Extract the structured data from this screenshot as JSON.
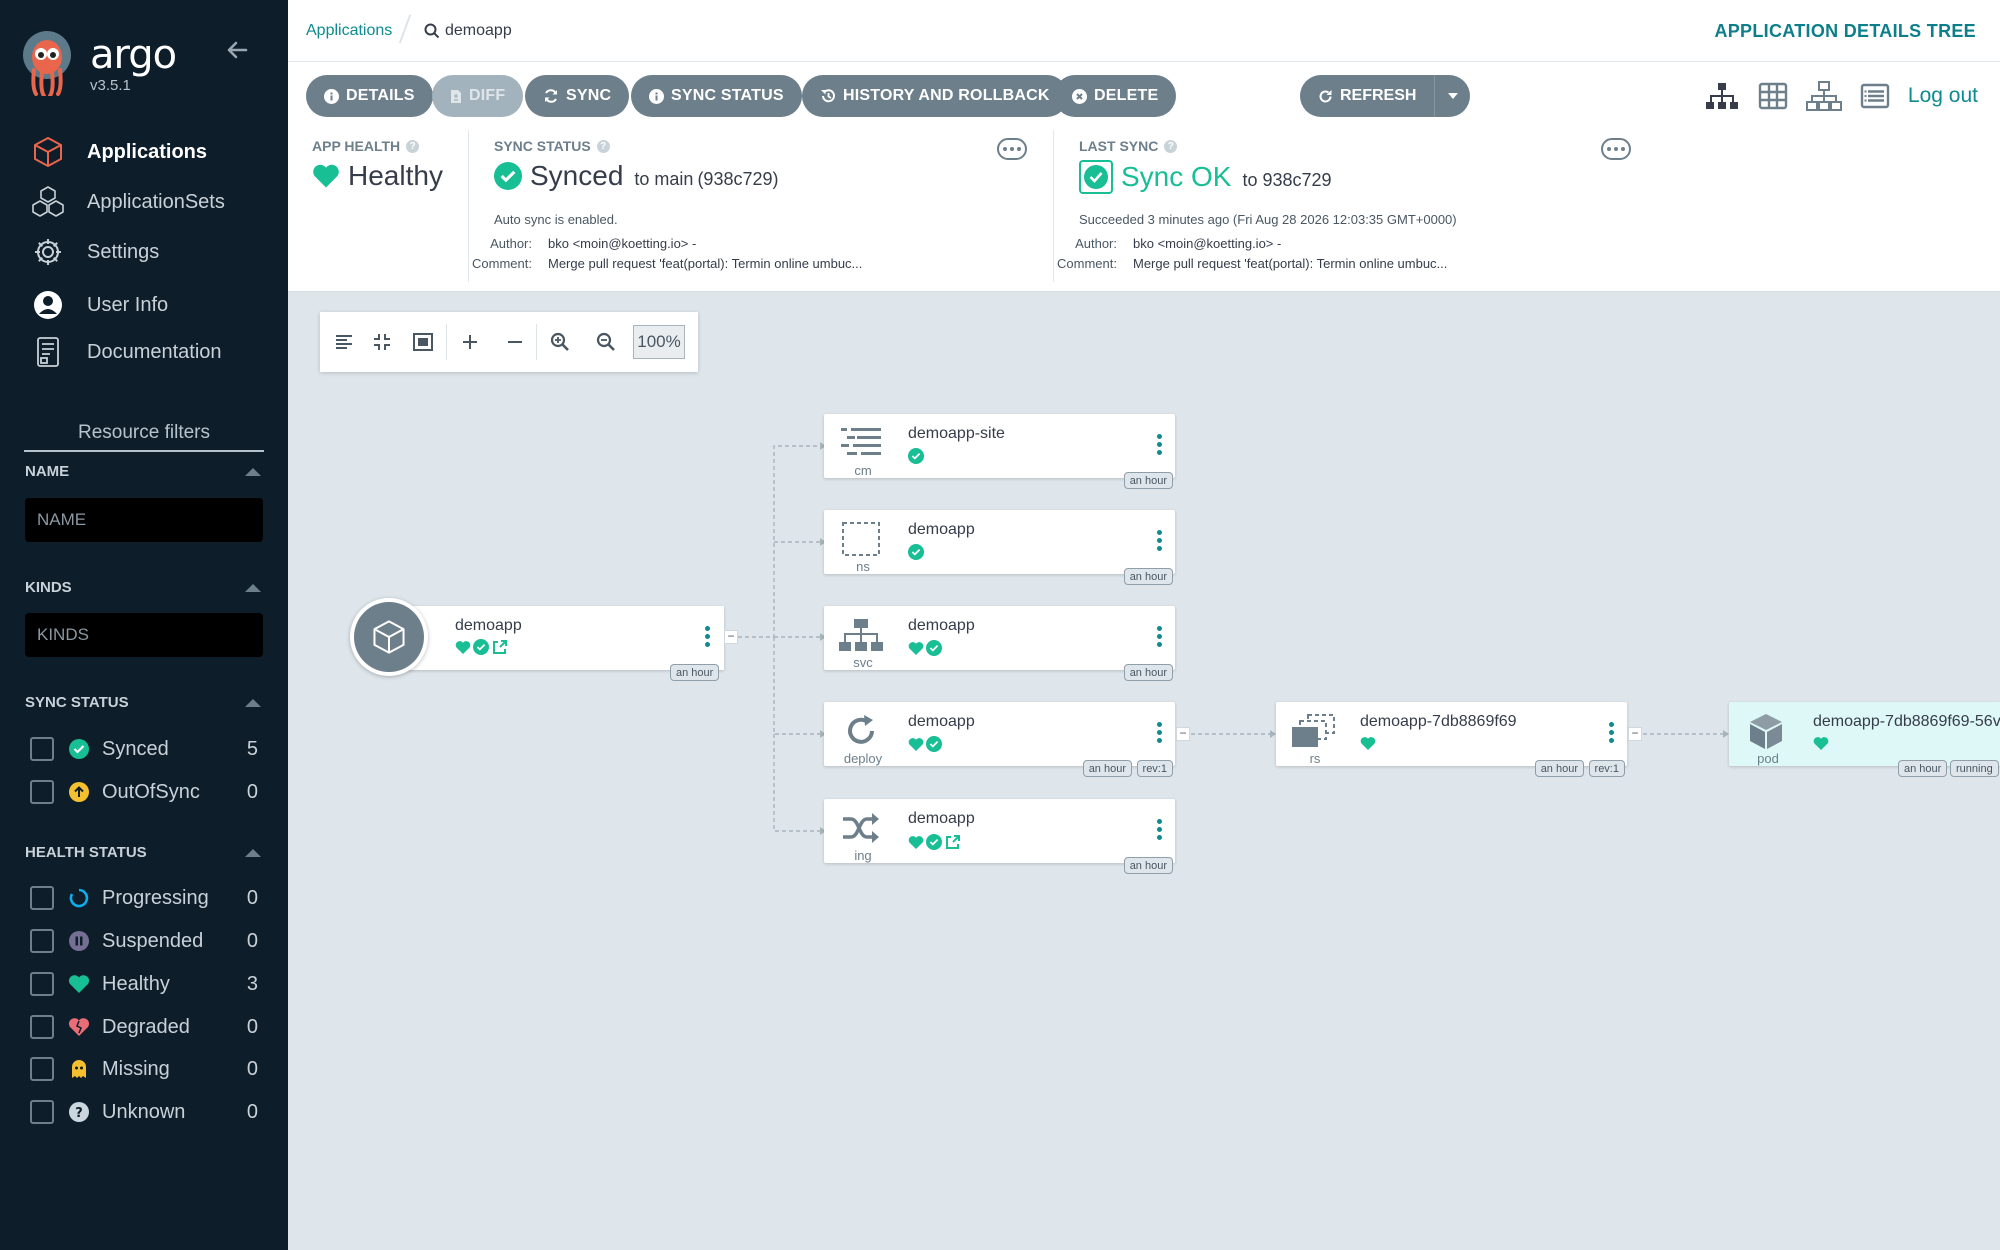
{
  "app": {
    "name": "argo",
    "version": "v3.5.1"
  },
  "sidebar": {
    "nav": [
      {
        "label": "Applications",
        "icon": "cube-icon",
        "active": true
      },
      {
        "label": "ApplicationSets",
        "icon": "cubes-icon",
        "active": false
      },
      {
        "label": "Settings",
        "icon": "gear-icon",
        "active": false
      },
      {
        "label": "User Info",
        "icon": "user-circle-icon",
        "active": false
      },
      {
        "label": "Documentation",
        "icon": "book-icon",
        "active": false
      }
    ],
    "resource_filters_title": "Resource filters",
    "name_filter": {
      "label": "NAME",
      "placeholder": "NAME"
    },
    "kinds_filter": {
      "label": "KINDS",
      "placeholder": "KINDS"
    },
    "sync_status": {
      "label": "SYNC STATUS",
      "items": [
        {
          "label": "Synced",
          "count": "5",
          "icon": "check-circle-icon",
          "color": "#18be94"
        },
        {
          "label": "OutOfSync",
          "count": "0",
          "icon": "arrow-up-circle-icon",
          "color": "#f4c030"
        }
      ]
    },
    "health_status": {
      "label": "HEALTH STATUS",
      "items": [
        {
          "label": "Progressing",
          "count": "0",
          "icon": "progress-circle-icon",
          "color": "#0dadea"
        },
        {
          "label": "Suspended",
          "count": "0",
          "icon": "pause-circle-icon",
          "color": "#766f94"
        },
        {
          "label": "Healthy",
          "count": "3",
          "icon": "heart-icon",
          "color": "#18be94"
        },
        {
          "label": "Degraded",
          "count": "0",
          "icon": "heart-broken-icon",
          "color": "#e96d76"
        },
        {
          "label": "Missing",
          "count": "0",
          "icon": "ghost-icon",
          "color": "#f4c030"
        },
        {
          "label": "Unknown",
          "count": "0",
          "icon": "question-circle-icon",
          "color": "#ccd6dd"
        }
      ]
    }
  },
  "topbar": {
    "breadcrumb_link": "Applications",
    "breadcrumb_current": "demoapp",
    "title": "APPLICATION DETAILS TREE"
  },
  "toolbar": {
    "details": "DETAILS",
    "diff": "DIFF",
    "sync": "SYNC",
    "sync_status": "SYNC STATUS",
    "history": "HISTORY AND ROLLBACK",
    "delete": "DELETE",
    "refresh": "REFRESH",
    "logout": "Log out"
  },
  "status": {
    "app_health": {
      "label": "APP HEALTH",
      "value": "Healthy"
    },
    "sync_status": {
      "label": "SYNC STATUS",
      "value": "Synced",
      "to": "to main",
      "revision": "(938c729)",
      "note": "Auto sync is enabled.",
      "author_label": "Author:",
      "author": "bko <moin@koetting.io> -",
      "comment_label": "Comment:",
      "comment": "Merge pull request 'feat(portal): Termin online umbuc..."
    },
    "last_sync": {
      "label": "LAST SYNC",
      "value": "Sync OK",
      "to": "to 938c729",
      "note": "Succeeded 3 minutes ago (Fri Aug 28 2026 12:03:35 GMT+0000)",
      "author_label": "Author:",
      "author": "bko <moin@koetting.io> -",
      "comment_label": "Comment:",
      "comment": "Merge pull request 'feat(portal): Termin online umbuc..."
    }
  },
  "graph": {
    "zoom": "100%",
    "app_node": {
      "name": "demoapp",
      "age": "an hour"
    },
    "nodes": [
      {
        "name": "demoapp-site",
        "kind": "cm",
        "age": "an hour"
      },
      {
        "name": "demoapp",
        "kind": "ns",
        "age": "an hour"
      },
      {
        "name": "demoapp",
        "kind": "svc",
        "age": "an hour"
      },
      {
        "name": "demoapp",
        "kind": "deploy",
        "age": "an hour",
        "rev": "rev:1"
      },
      {
        "name": "demoapp",
        "kind": "ing",
        "age": "an hour"
      },
      {
        "name": "demoapp-7db8869f69",
        "kind": "rs",
        "age": "an hour",
        "rev": "rev:1"
      },
      {
        "name": "demoapp-7db8869f69-56v",
        "kind": "pod",
        "age": "an hour",
        "state": "running"
      }
    ]
  },
  "colors": {
    "accent": "#0d8b8f",
    "healthy": "#18be94",
    "sidebar_bg": "#0d1d2a",
    "button_bg": "#6d7f8b"
  }
}
